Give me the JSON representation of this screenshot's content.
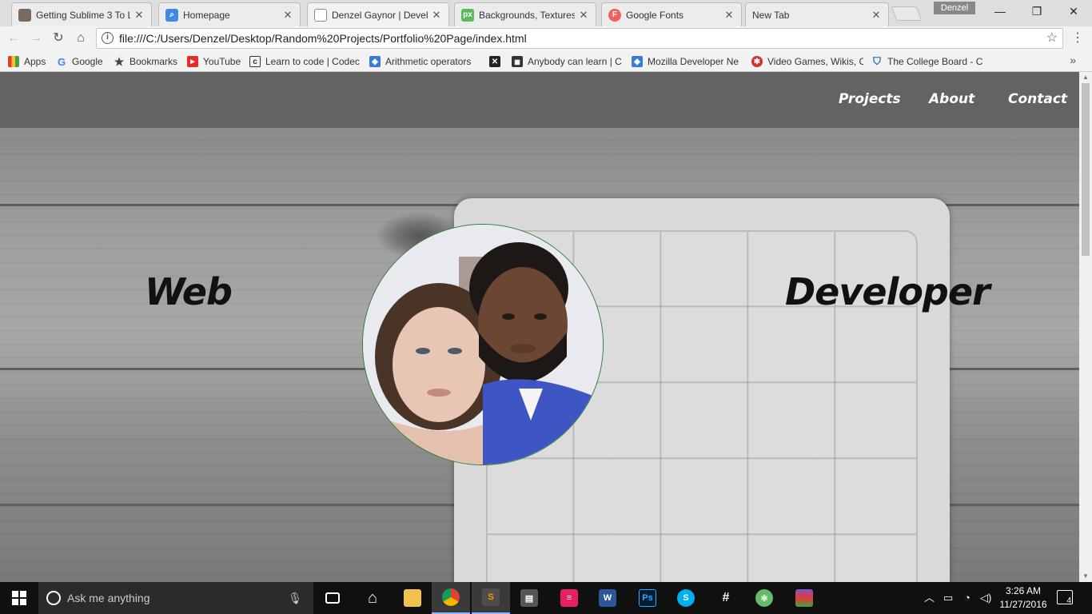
{
  "browser": {
    "tabs": [
      {
        "title": "Getting Sublime 3 To L",
        "favicon": "user-avatar-icon"
      },
      {
        "title": "Homepage",
        "favicon": "search-favicon-icon"
      },
      {
        "title": "Denzel Gaynor | Develo",
        "favicon": "page-icon"
      },
      {
        "title": "Backgrounds, Textures",
        "favicon": "px-icon"
      },
      {
        "title": "Google Fonts",
        "favicon": "google-fonts-icon"
      },
      {
        "title": "New Tab",
        "favicon": ""
      }
    ],
    "profile_name": "Denzel",
    "url": "file:///C:/Users/Denzel/Desktop/Random%20Projects/Portfolio%20Page/index.html",
    "bookmarks": [
      {
        "label": "Apps",
        "icon": "apps-grid-icon"
      },
      {
        "label": "Google",
        "icon": "google-g-icon"
      },
      {
        "label": "Bookmarks",
        "icon": "star-icon"
      },
      {
        "label": "YouTube",
        "icon": "youtube-icon"
      },
      {
        "label": "Learn to code | Codec",
        "icon": "codecademy-icon"
      },
      {
        "label": "Arithmetic operators",
        "icon": "mdn-icon"
      },
      {
        "label": "",
        "icon": "x-box-icon"
      },
      {
        "label": "Anybody can learn | C",
        "icon": "code-org-icon"
      },
      {
        "label": "Mozilla Developer Ne",
        "icon": "mdn-icon"
      },
      {
        "label": "Video Games, Wikis, C",
        "icon": "wikia-icon"
      },
      {
        "label": "The College Board - C",
        "icon": "college-board-icon"
      }
    ]
  },
  "site": {
    "nav": [
      "Projects",
      "About",
      "Contact"
    ],
    "hero_left": "Web",
    "hero_right": "Developer",
    "colors": {
      "nav_bg": "#636363",
      "portrait_border": "#2e7d32"
    }
  },
  "taskbar": {
    "search_placeholder": "Ask me anything",
    "time": "3:26 AM",
    "date": "11/27/2016",
    "notification_count": "4",
    "apps": [
      "task-view-icon",
      "edge-icon",
      "file-explorer-icon",
      "chrome-icon",
      "sublime-text-icon",
      "video-editor-icon",
      "music-app-icon",
      "word-icon",
      "photoshop-icon",
      "skype-icon",
      "slack-icon",
      "atom-icon",
      "winrar-icon"
    ]
  }
}
